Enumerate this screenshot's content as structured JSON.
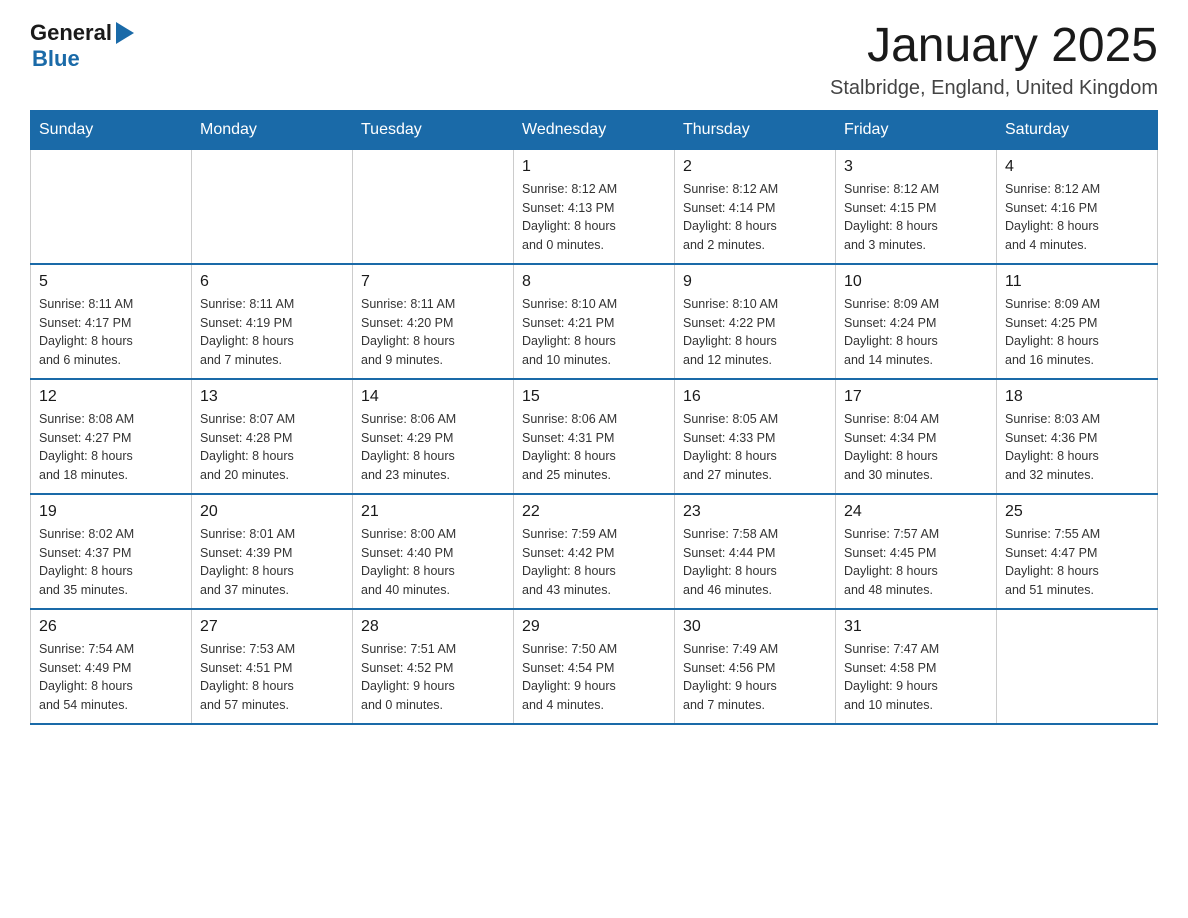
{
  "header": {
    "logo_general": "General",
    "logo_blue": "Blue",
    "calendar_title": "January 2025",
    "location": "Stalbridge, England, United Kingdom"
  },
  "days_of_week": [
    "Sunday",
    "Monday",
    "Tuesday",
    "Wednesday",
    "Thursday",
    "Friday",
    "Saturday"
  ],
  "weeks": [
    [
      {
        "day": "",
        "info": ""
      },
      {
        "day": "",
        "info": ""
      },
      {
        "day": "",
        "info": ""
      },
      {
        "day": "1",
        "info": "Sunrise: 8:12 AM\nSunset: 4:13 PM\nDaylight: 8 hours\nand 0 minutes."
      },
      {
        "day": "2",
        "info": "Sunrise: 8:12 AM\nSunset: 4:14 PM\nDaylight: 8 hours\nand 2 minutes."
      },
      {
        "day": "3",
        "info": "Sunrise: 8:12 AM\nSunset: 4:15 PM\nDaylight: 8 hours\nand 3 minutes."
      },
      {
        "day": "4",
        "info": "Sunrise: 8:12 AM\nSunset: 4:16 PM\nDaylight: 8 hours\nand 4 minutes."
      }
    ],
    [
      {
        "day": "5",
        "info": "Sunrise: 8:11 AM\nSunset: 4:17 PM\nDaylight: 8 hours\nand 6 minutes."
      },
      {
        "day": "6",
        "info": "Sunrise: 8:11 AM\nSunset: 4:19 PM\nDaylight: 8 hours\nand 7 minutes."
      },
      {
        "day": "7",
        "info": "Sunrise: 8:11 AM\nSunset: 4:20 PM\nDaylight: 8 hours\nand 9 minutes."
      },
      {
        "day": "8",
        "info": "Sunrise: 8:10 AM\nSunset: 4:21 PM\nDaylight: 8 hours\nand 10 minutes."
      },
      {
        "day": "9",
        "info": "Sunrise: 8:10 AM\nSunset: 4:22 PM\nDaylight: 8 hours\nand 12 minutes."
      },
      {
        "day": "10",
        "info": "Sunrise: 8:09 AM\nSunset: 4:24 PM\nDaylight: 8 hours\nand 14 minutes."
      },
      {
        "day": "11",
        "info": "Sunrise: 8:09 AM\nSunset: 4:25 PM\nDaylight: 8 hours\nand 16 minutes."
      }
    ],
    [
      {
        "day": "12",
        "info": "Sunrise: 8:08 AM\nSunset: 4:27 PM\nDaylight: 8 hours\nand 18 minutes."
      },
      {
        "day": "13",
        "info": "Sunrise: 8:07 AM\nSunset: 4:28 PM\nDaylight: 8 hours\nand 20 minutes."
      },
      {
        "day": "14",
        "info": "Sunrise: 8:06 AM\nSunset: 4:29 PM\nDaylight: 8 hours\nand 23 minutes."
      },
      {
        "day": "15",
        "info": "Sunrise: 8:06 AM\nSunset: 4:31 PM\nDaylight: 8 hours\nand 25 minutes."
      },
      {
        "day": "16",
        "info": "Sunrise: 8:05 AM\nSunset: 4:33 PM\nDaylight: 8 hours\nand 27 minutes."
      },
      {
        "day": "17",
        "info": "Sunrise: 8:04 AM\nSunset: 4:34 PM\nDaylight: 8 hours\nand 30 minutes."
      },
      {
        "day": "18",
        "info": "Sunrise: 8:03 AM\nSunset: 4:36 PM\nDaylight: 8 hours\nand 32 minutes."
      }
    ],
    [
      {
        "day": "19",
        "info": "Sunrise: 8:02 AM\nSunset: 4:37 PM\nDaylight: 8 hours\nand 35 minutes."
      },
      {
        "day": "20",
        "info": "Sunrise: 8:01 AM\nSunset: 4:39 PM\nDaylight: 8 hours\nand 37 minutes."
      },
      {
        "day": "21",
        "info": "Sunrise: 8:00 AM\nSunset: 4:40 PM\nDaylight: 8 hours\nand 40 minutes."
      },
      {
        "day": "22",
        "info": "Sunrise: 7:59 AM\nSunset: 4:42 PM\nDaylight: 8 hours\nand 43 minutes."
      },
      {
        "day": "23",
        "info": "Sunrise: 7:58 AM\nSunset: 4:44 PM\nDaylight: 8 hours\nand 46 minutes."
      },
      {
        "day": "24",
        "info": "Sunrise: 7:57 AM\nSunset: 4:45 PM\nDaylight: 8 hours\nand 48 minutes."
      },
      {
        "day": "25",
        "info": "Sunrise: 7:55 AM\nSunset: 4:47 PM\nDaylight: 8 hours\nand 51 minutes."
      }
    ],
    [
      {
        "day": "26",
        "info": "Sunrise: 7:54 AM\nSunset: 4:49 PM\nDaylight: 8 hours\nand 54 minutes."
      },
      {
        "day": "27",
        "info": "Sunrise: 7:53 AM\nSunset: 4:51 PM\nDaylight: 8 hours\nand 57 minutes."
      },
      {
        "day": "28",
        "info": "Sunrise: 7:51 AM\nSunset: 4:52 PM\nDaylight: 9 hours\nand 0 minutes."
      },
      {
        "day": "29",
        "info": "Sunrise: 7:50 AM\nSunset: 4:54 PM\nDaylight: 9 hours\nand 4 minutes."
      },
      {
        "day": "30",
        "info": "Sunrise: 7:49 AM\nSunset: 4:56 PM\nDaylight: 9 hours\nand 7 minutes."
      },
      {
        "day": "31",
        "info": "Sunrise: 7:47 AM\nSunset: 4:58 PM\nDaylight: 9 hours\nand 10 minutes."
      },
      {
        "day": "",
        "info": ""
      }
    ]
  ]
}
